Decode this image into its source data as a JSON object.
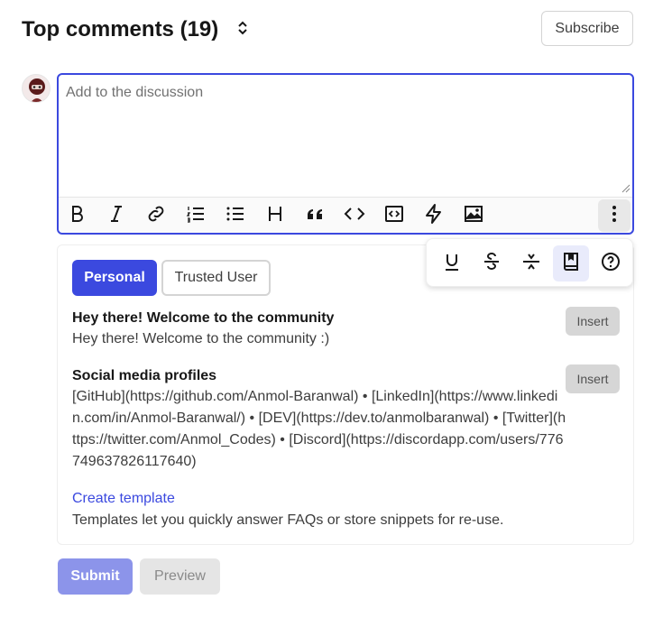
{
  "header": {
    "title": "Top comments (19)",
    "subscribe_label": "Subscribe"
  },
  "editor": {
    "placeholder": "Add to the discussion",
    "value": "",
    "toolbar": [
      "bold-icon",
      "italic-icon",
      "link-icon",
      "ordered-list-icon",
      "unordered-list-icon",
      "heading-icon",
      "quote-icon",
      "code-icon",
      "code-block-icon",
      "embed-icon",
      "image-icon",
      "more-icon"
    ],
    "more_menu": [
      "underline-icon",
      "strikethrough-icon",
      "divider-icon",
      "templates-icon",
      "help-icon"
    ]
  },
  "templates": {
    "tabs": [
      {
        "label": "Personal",
        "active": true
      },
      {
        "label": "Trusted User",
        "active": false
      }
    ],
    "items": [
      {
        "title": "Hey there! Welcome to the community",
        "body": "Hey there! Welcome to the community :)",
        "insert_label": "Insert"
      },
      {
        "title": "Social media profiles",
        "body": "[GitHub](https://github.com/Anmol-Baranwal) • [LinkedIn](https://www.linkedin.com/in/Anmol-Baranwal/) • [DEV](https://dev.to/anmolbaranwal) • [Twitter](https://twitter.com/Anmol_Codes) • [Discord](https://discordapp.com/users/776749637826117640)",
        "insert_label": "Insert"
      }
    ],
    "create_label": "Create template",
    "hint": "Templates let you quickly answer FAQs or store snippets for re-use."
  },
  "actions": {
    "submit_label": "Submit",
    "preview_label": "Preview"
  },
  "colors": {
    "accent": "#3b49df",
    "submit_disabled": "#8c94ea",
    "insert_bg": "#d6d6d6"
  }
}
